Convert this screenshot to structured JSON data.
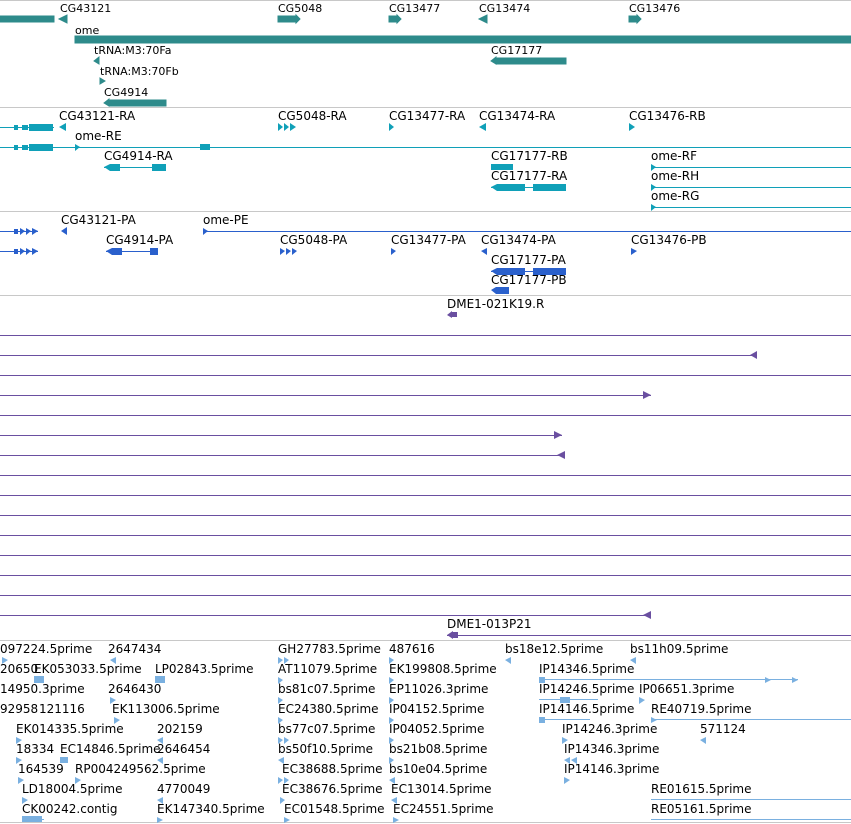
{
  "colors": {
    "gene": "#2e8b8b",
    "transcript": "#10a0b8",
    "protein": "#2a60cc",
    "clone": "#6a4fa0",
    "est": "#7ab0e0",
    "divider": "#c8c8c8"
  },
  "gene_track": {
    "labels": [
      "CG43121",
      "CG5048",
      "CG13477",
      "CG13474",
      "CG13476",
      "ome",
      "tRNA:M3:70Fa",
      "CG17177",
      "tRNA:M3:70Fb",
      "CG4914"
    ]
  },
  "transcript_track": {
    "labels": [
      "CG43121-RA",
      "CG5048-RA",
      "CG13477-RA",
      "CG13474-RA",
      "CG13476-RB",
      "ome-RE",
      "CG4914-RA",
      "CG17177-RB",
      "ome-RF",
      "CG17177-RA",
      "ome-RH",
      "ome-RG"
    ]
  },
  "protein_track": {
    "labels": [
      "CG43121-PA",
      "ome-PE",
      "CG4914-PA",
      "CG5048-PA",
      "CG13477-PA",
      "CG13474-PA",
      "CG13476-PB",
      "CG17177-PA",
      "CG17177-PB"
    ]
  },
  "clone_track": {
    "labels": [
      "DME1-021K19.R",
      "DME1-013P21"
    ]
  },
  "est_track": {
    "labels": [
      "097224.5prime",
      "2647434",
      "GH27783.5prime",
      "487616",
      "bs18e12.5prime",
      "bs11h09.5prime",
      "20650",
      "EK053033.5prime",
      "LP02843.5prime",
      "AT11079.5prime",
      "EK199808.5prime",
      "IP14346.5prime",
      "14950.3prime",
      "2646430",
      "bs81c07.5prime",
      "EP11026.3prime",
      "IP14246.5prime",
      "IP06651.3prime",
      "92958",
      "121116",
      "EK113006.5prime",
      "EC24380.5prime",
      "IP04152.5prime",
      "IP14146.5prime",
      "RE40719.5prime",
      "EK014335.5prime",
      "202159",
      "bs77c07.5prime",
      "IP04052.5prime",
      "IP14246.3prime",
      "571124",
      "18334",
      "EC14846.5prime",
      "2646454",
      "bs50f10.5prime",
      "bs21b08.5prime",
      "IP14346.3prime",
      "164539",
      "RP004249562.5prime",
      "EC38688.5prime",
      "bs10e04.5prime",
      "IP14146.3prime",
      "LD18004.5prime",
      "4770049",
      "EC38676.5prime",
      "EC13014.5prime",
      "RE01615.5prime",
      "CK00242.contig",
      "EK147340.5prime",
      "EC01548.5prime",
      "EC24551.5prime",
      "RE05161.5prime"
    ]
  }
}
